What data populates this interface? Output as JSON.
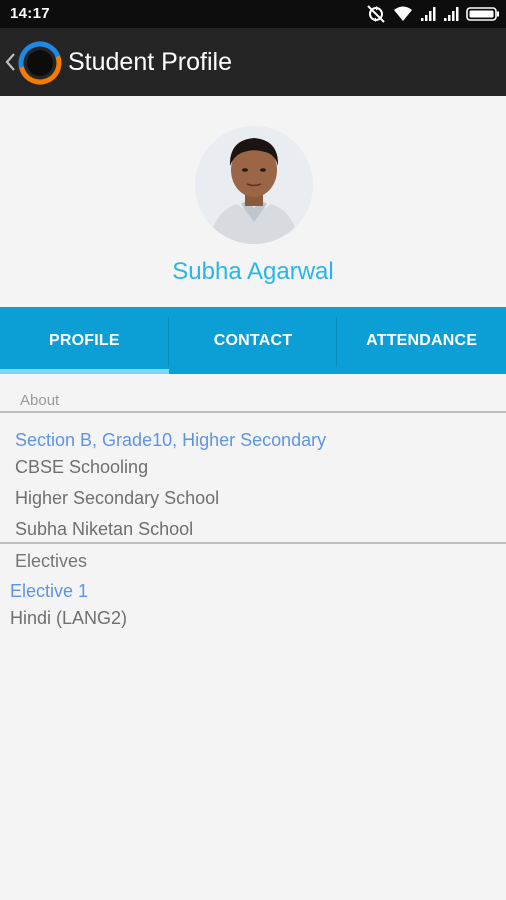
{
  "status_bar": {
    "time": "14:17",
    "icons": [
      "sync-off-icon",
      "wifi-icon",
      "signal-icon",
      "signal-icon",
      "battery-icon"
    ]
  },
  "app_bar": {
    "title": "Student Profile",
    "back_icon": "chevron-left-icon",
    "logo_icon": "app-logo-icon"
  },
  "profile": {
    "name": "Subha Agarwal"
  },
  "tabs": [
    {
      "label": "PROFILE",
      "selected": true
    },
    {
      "label": "CONTACT",
      "selected": false
    },
    {
      "label": "ATTENDANCE",
      "selected": false
    }
  ],
  "about": {
    "header": "About",
    "class_info": "Section B, Grade10, Higher Secondary",
    "board": "CBSE Schooling",
    "school_level": "Higher Secondary School",
    "school_name": "Subha Niketan School"
  },
  "electives": {
    "header": "Electives",
    "items": [
      {
        "title": "Elective 1",
        "value": "Hindi (LANG2)"
      }
    ]
  },
  "colors": {
    "accent": "#0b9fd6",
    "name_color": "#29b6e6",
    "link_blue": "#5d94e6",
    "app_bar": "#252525"
  }
}
